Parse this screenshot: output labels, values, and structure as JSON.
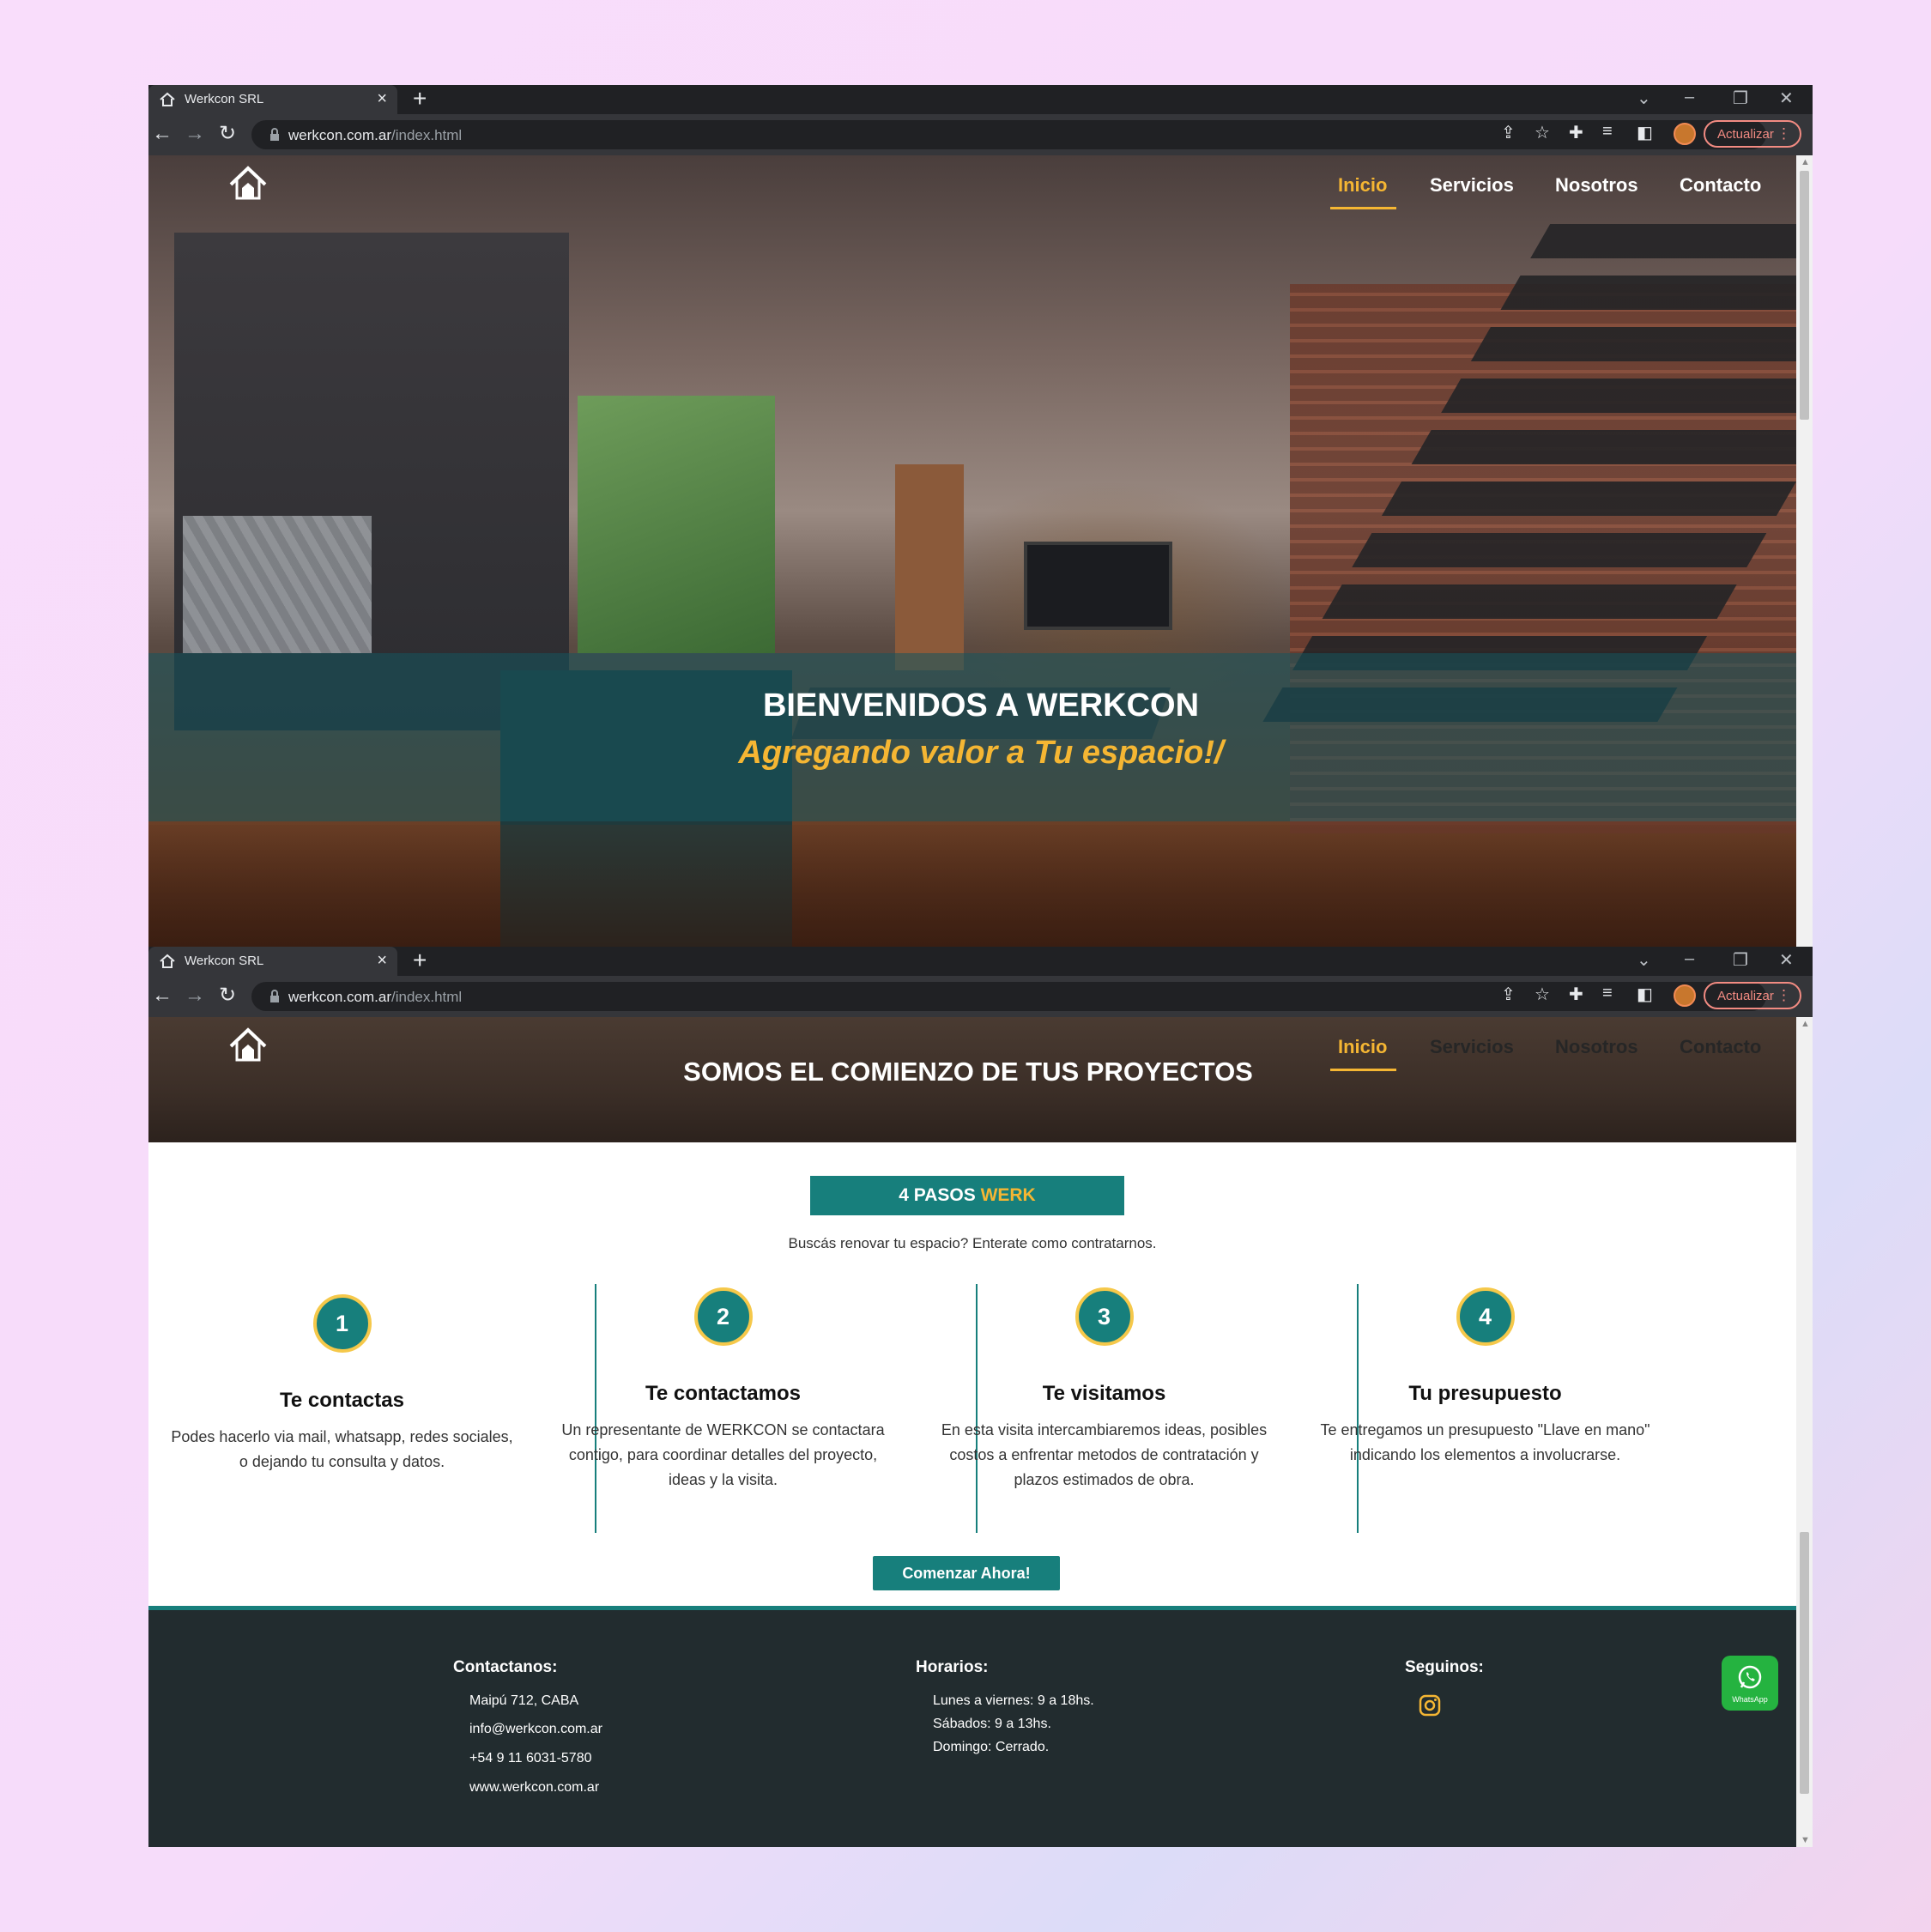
{
  "browser": {
    "tab_title": "Werkcon SRL",
    "new_tab": "+",
    "url_domain": "werkcon.com.ar",
    "url_path": "/index.html",
    "update_label": "Actualizar"
  },
  "site": {
    "nav": [
      "Inicio",
      "Servicios",
      "Nosotros",
      "Contacto"
    ],
    "active_nav": "Inicio",
    "accent_color": "#f5b633",
    "brand_color": "#177f7c"
  },
  "hero": {
    "title": "BIENVENIDOS A WERKCON",
    "subtitle": "Agregando valor a Tu espacio!/"
  },
  "about": {
    "banner_title": "SOMOS EL COMIENZO DE TUS PROYECTOS",
    "badge_prefix": "4 PASOS ",
    "badge_accent": "WERK",
    "intro": "Buscás renovar tu espacio? Enterate como contratarnos.",
    "steps": [
      {
        "number": "1",
        "title": "Te contactas",
        "text": "Podes hacerlo via mail, whatsapp, redes sociales, o dejando tu consulta y datos."
      },
      {
        "number": "2",
        "title": "Te contactamos",
        "text": "Un representante de WERKCON se contactara contigo, para coordinar detalles del proyecto, ideas y la visita."
      },
      {
        "number": "3",
        "title": "Te visitamos",
        "text": "En esta visita intercambiaremos ideas, posibles costos a enfrentar metodos de contratación y plazos estimados de obra."
      },
      {
        "number": "4",
        "title": "Tu presupuesto",
        "text": "Te entregamos un presupuesto \"Llave en mano\" indicando los elementos a involucrarse."
      }
    ],
    "cta_label": "Comenzar Ahora!"
  },
  "footer": {
    "contact_heading": "Contactanos:",
    "contact_lines": [
      "Maipú 712, CABA",
      "info@werkcon.com.ar",
      "+54 9 11 6031-5780",
      "www.werkcon.com.ar"
    ],
    "hours_heading": "Horarios:",
    "hours_lines": [
      "Lunes a viernes: 9 a 18hs.",
      "Sábados: 9 a 13hs.",
      "Domingo: Cerrado."
    ],
    "social_heading": "Seguinos:",
    "social_icon": "instagram-icon",
    "whatsapp_label": "WhatsApp"
  }
}
